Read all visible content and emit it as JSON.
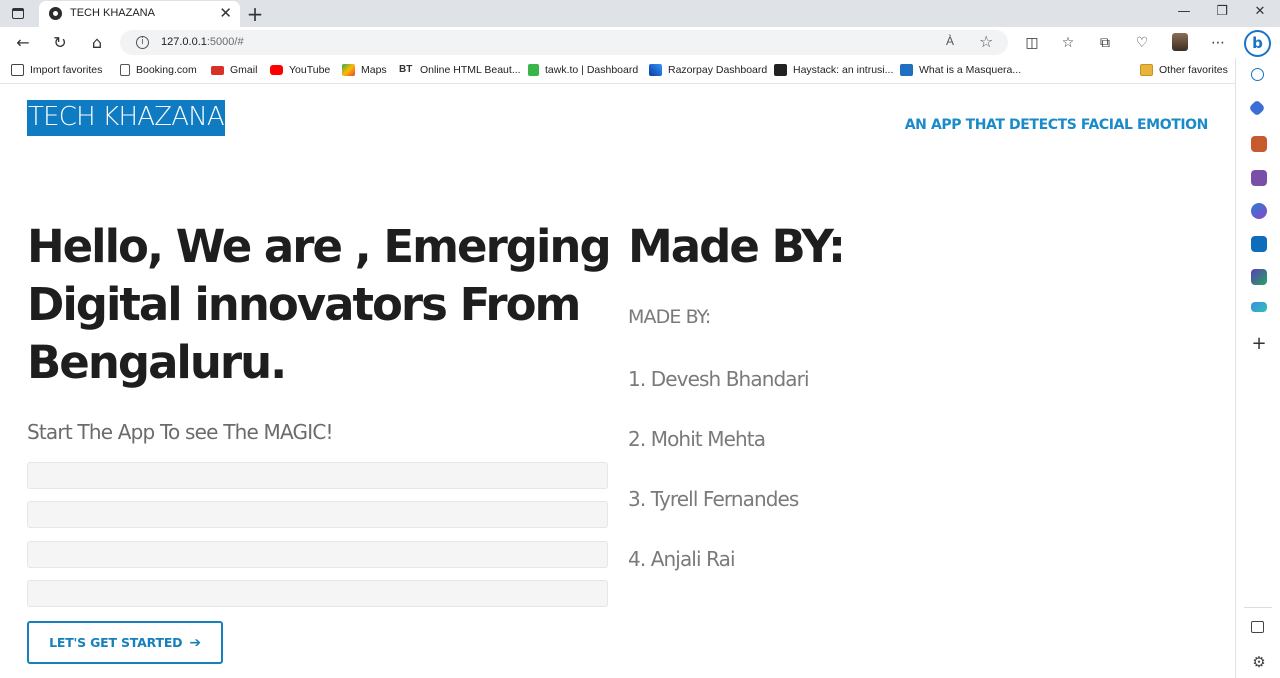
{
  "browser": {
    "tab_title": "TECH KHAZANA",
    "tab_close": "✕",
    "new_tab": "+",
    "url_host": "127.0.0.1",
    "url_rest": ":5000/#",
    "read_aloud": "À",
    "window_controls": {
      "minimize": "—",
      "maximize": "❐",
      "close": "✕"
    }
  },
  "bookmarks": [
    {
      "label": "Import favorites",
      "color": "#444444"
    },
    {
      "label": "Booking.com",
      "color": "#555555"
    },
    {
      "label": "Gmail",
      "color": "#d93025"
    },
    {
      "label": "YouTube",
      "color": "#ff0000"
    },
    {
      "label": "Maps",
      "color": "#34a853"
    },
    {
      "label": "Online HTML Beaut...",
      "color": "#333333"
    },
    {
      "label": "tawk.to | Dashboard",
      "color": "#39b54a"
    },
    {
      "label": "Razorpay Dashboard",
      "color": "#0c3c9b"
    },
    {
      "label": "Haystack: an intrusi...",
      "color": "#222222"
    },
    {
      "label": "What is a Masquera...",
      "color": "#1f6fbf"
    },
    {
      "label": "Other favorites",
      "color": "#e8b53c"
    }
  ],
  "page": {
    "brand": "TECH KHAZANA",
    "tagline": "AN APP THAT DETECTS FACIAL EMOTION",
    "hero_heading": "Hello, We are , Emerging Digital innovators From Bengaluru.",
    "subtitle": "Start The App To see The MAGIC!",
    "cta_label": "LET'S GET STARTED",
    "cta_arrow": "➔",
    "made_by_title": "Made BY:",
    "made_by_label": "MADE BY:",
    "members": [
      "1. Devesh Bhandari",
      "2. Mohit Mehta",
      "3. Tyrell Fernandes",
      "4. Anjali Rai"
    ]
  },
  "colors": {
    "brand_bg": "#0e7bc2",
    "accent": "#1680bb"
  }
}
